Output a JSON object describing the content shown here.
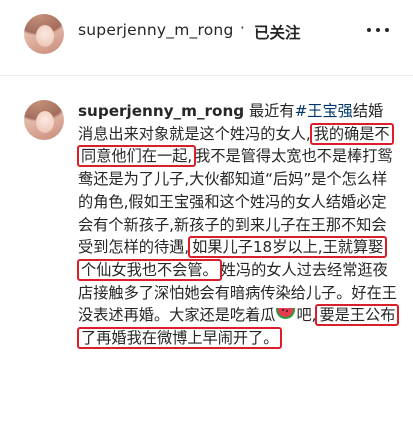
{
  "header": {
    "username": "superjenny_m_rong",
    "dot": "·",
    "follow_status": "已关注",
    "more_icon": "more-horizontal-icon"
  },
  "post": {
    "username": "superjenny_m_rong",
    "segments": {
      "s1": " 最近有",
      "hashtag": "#王宝强",
      "s2": "结婚消息出来对象就是这个姓冯的女人,",
      "h1": "我的确是不同意他们在一起,",
      "s3": "我不是管得太宽也不是棒打鸳鸯还是为了儿子,大伙都知道“后妈”是个怎么样的角色,假如王宝强和这个姓冯的女人结婚必定会有个新孩子,新孩子的到来儿子在王那不知会受到怎样的待遇,",
      "h2": "如果儿子18岁以上,王就算娶个仙女我也不会管。",
      "s4": "姓冯的女人过去经常逛夜店接触多了深怕她会有暗病传染给儿子。好在王没表述再婚。大家还是吃着瓜",
      "emoji_name": "watermelon-emoji",
      "s5": "吧,",
      "h3": "要是王公布了再婚我在微博上早闹开了。"
    }
  },
  "colors": {
    "highlight_border": "#d9202a",
    "hashtag": "#00376b",
    "text": "#262626"
  }
}
